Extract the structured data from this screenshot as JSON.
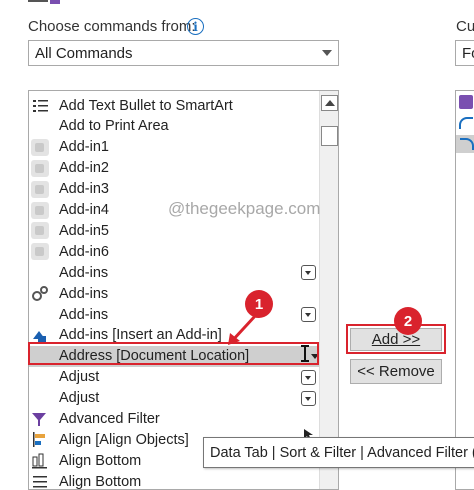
{
  "choose_label": "Choose commands from:",
  "choose_value": "All Commands",
  "right_label_partial": "Cus",
  "right_dropdown_partial": "Fo",
  "watermark": "@thegeekpage.com",
  "commands": [
    {
      "label": "Add Text Bullet to SmartArt",
      "icon": "list-icon",
      "submenu": false
    },
    {
      "label": "Add to Print Area",
      "icon": "none",
      "submenu": false
    },
    {
      "label": "Add-in1",
      "icon": "addin-icon",
      "submenu": false
    },
    {
      "label": "Add-in2",
      "icon": "addin-icon",
      "submenu": false
    },
    {
      "label": "Add-in3",
      "icon": "addin-icon",
      "submenu": false
    },
    {
      "label": "Add-in4",
      "icon": "addin-icon",
      "submenu": false
    },
    {
      "label": "Add-in5",
      "icon": "addin-icon",
      "submenu": false
    },
    {
      "label": "Add-in6",
      "icon": "addin-icon",
      "submenu": false
    },
    {
      "label": "Add-ins",
      "icon": "none",
      "submenu": true
    },
    {
      "label": "Add-ins",
      "icon": "gears-icon",
      "submenu": false
    },
    {
      "label": "Add-ins",
      "icon": "none",
      "submenu": true
    },
    {
      "label": "Add-ins [Insert an Add-in]",
      "icon": "shapes-icon",
      "submenu": false
    },
    {
      "label": "Address [Document Location]",
      "icon": "none",
      "submenu": false,
      "selected": true
    },
    {
      "label": "Adjust",
      "icon": "none",
      "submenu": true
    },
    {
      "label": "Adjust",
      "icon": "none",
      "submenu": true
    },
    {
      "label": "Advanced Filter",
      "icon": "filter-icon",
      "submenu": false
    },
    {
      "label": "Align [Align Objects]",
      "icon": "align-icon",
      "submenu": false
    },
    {
      "label": "Align Bottom",
      "icon": "align-bottom-icon",
      "submenu": false
    },
    {
      "label": "Align Bottom",
      "icon": "align-lines-icon",
      "submenu": false
    }
  ],
  "add_button": "Add >>",
  "remove_button": "<< Remove",
  "tooltip": "Data Tab | Sort & Filter | Advanced Filter (A",
  "badges": {
    "one": "1",
    "two": "2"
  },
  "colors": {
    "highlight": "#d9232d",
    "accent": "#1a6fc0",
    "selection": "#cfcfcf"
  }
}
